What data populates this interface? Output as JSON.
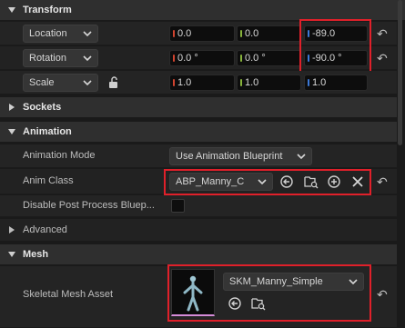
{
  "sections": {
    "transform": "Transform",
    "sockets": "Sockets",
    "animation": "Animation",
    "advanced": "Advanced",
    "mesh": "Mesh"
  },
  "transform": {
    "location": {
      "label": "Location",
      "x": "0.0",
      "y": "0.0",
      "z": "-89.0"
    },
    "rotation": {
      "label": "Rotation",
      "x": "0.0 °",
      "y": "0.0 °",
      "z": "-90.0 °"
    },
    "scale": {
      "label": "Scale",
      "x": "1.0",
      "y": "1.0",
      "z": "1.0"
    }
  },
  "animation": {
    "mode_label": "Animation Mode",
    "mode_value": "Use Animation Blueprint",
    "anim_class_label": "Anim Class",
    "anim_class_value": "ABP_Manny_C",
    "disable_pp_label": "Disable Post Process Bluep..."
  },
  "mesh": {
    "skeletal_mesh_label": "Skeletal Mesh Asset",
    "skeletal_mesh_value": "SKM_Manny_Simple"
  },
  "reset_glyph": "↶",
  "colors": {
    "highlight": "#e0202a",
    "x_axis": "#d2442f",
    "y_axis": "#87b33b",
    "z_axis": "#3b78d6"
  }
}
